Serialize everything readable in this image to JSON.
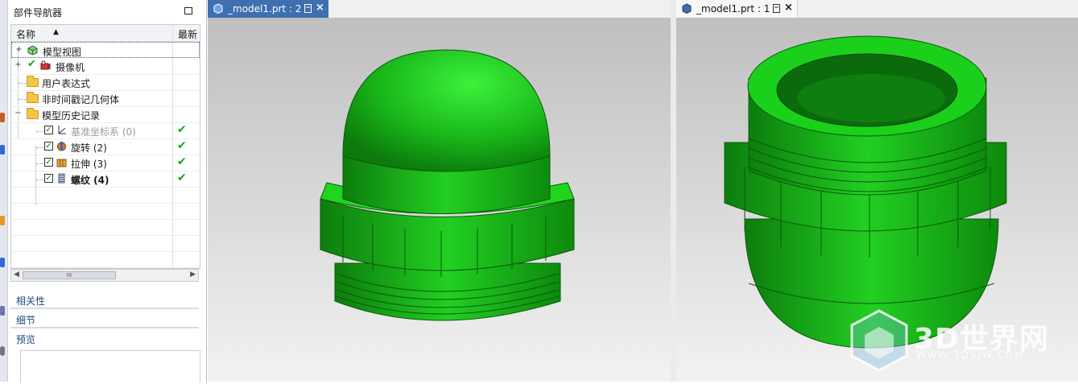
{
  "navigator": {
    "title": "部件导航器",
    "columns": {
      "name": "名称",
      "latest": "最新"
    },
    "tree": [
      {
        "label": "模型视图",
        "icon": "model-views-icon",
        "expander": "+"
      },
      {
        "label": "摄像机",
        "icon": "camera-icon",
        "expander": "+"
      },
      {
        "label": "用户表达式",
        "icon": "folder-icon"
      },
      {
        "label": "非时间戳记几何体",
        "icon": "folder-icon"
      },
      {
        "label": "模型历史记录",
        "icon": "folder-icon",
        "expander": "−"
      },
      {
        "label": "基准坐标系 (0)",
        "icon": "datum-csys-icon",
        "checked": true,
        "latest": "✔"
      },
      {
        "label": "旋转 (2)",
        "icon": "revolve-icon",
        "checked": true,
        "latest": "✔"
      },
      {
        "label": "拉伸 (3)",
        "icon": "extrude-icon",
        "checked": true,
        "latest": "✔"
      },
      {
        "label": "螺纹 (4)",
        "icon": "thread-icon",
        "checked": true,
        "latest": "✔"
      }
    ],
    "scroll_thumb": "III",
    "sections": [
      "相关性",
      "细节",
      "预览"
    ]
  },
  "tabs": [
    {
      "label": "_model1.prt : 2",
      "active": true
    },
    {
      "label": "_model1.prt : 1",
      "active": false
    }
  ],
  "watermark": {
    "text": "3D世界网",
    "url": "WWW.3DSJW.COM"
  },
  "colors": {
    "part_green": "#19c219",
    "tab_active": "#3e6fae",
    "section_text": "#1c4a7c"
  }
}
